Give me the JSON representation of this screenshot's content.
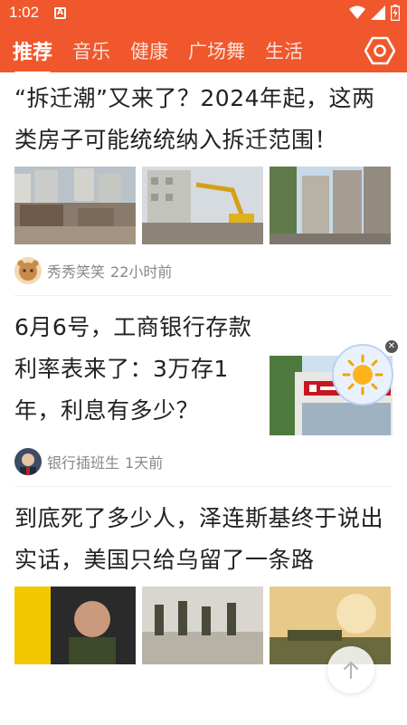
{
  "status": {
    "time": "1:02",
    "notif_glyph": "A"
  },
  "tabs": [
    {
      "label": "推荐"
    },
    {
      "label": "音乐"
    },
    {
      "label": "健康"
    },
    {
      "label": "广场舞"
    },
    {
      "label": "生活"
    }
  ],
  "articles": [
    {
      "title": "“拆迁潮”又来了？2024年起，这两类房子可能统统纳入拆迁范围！",
      "author": "秀秀笑笑",
      "time": "22小时前"
    },
    {
      "title": "6月6号，工商银行存款利率表来了：3万存1年，利息有多少？",
      "author": "银行插班生",
      "time": "1天前"
    },
    {
      "title": "到底死了多少人，泽连斯基终于说出实话，美国只给乌留了一条路"
    }
  ],
  "colors": {
    "brand": "#f0572c",
    "meta": "#888888"
  },
  "icons": {
    "settings": "settings-hexagon-icon",
    "weather": "sun-icon",
    "scroll_top": "arrow-up-icon"
  }
}
